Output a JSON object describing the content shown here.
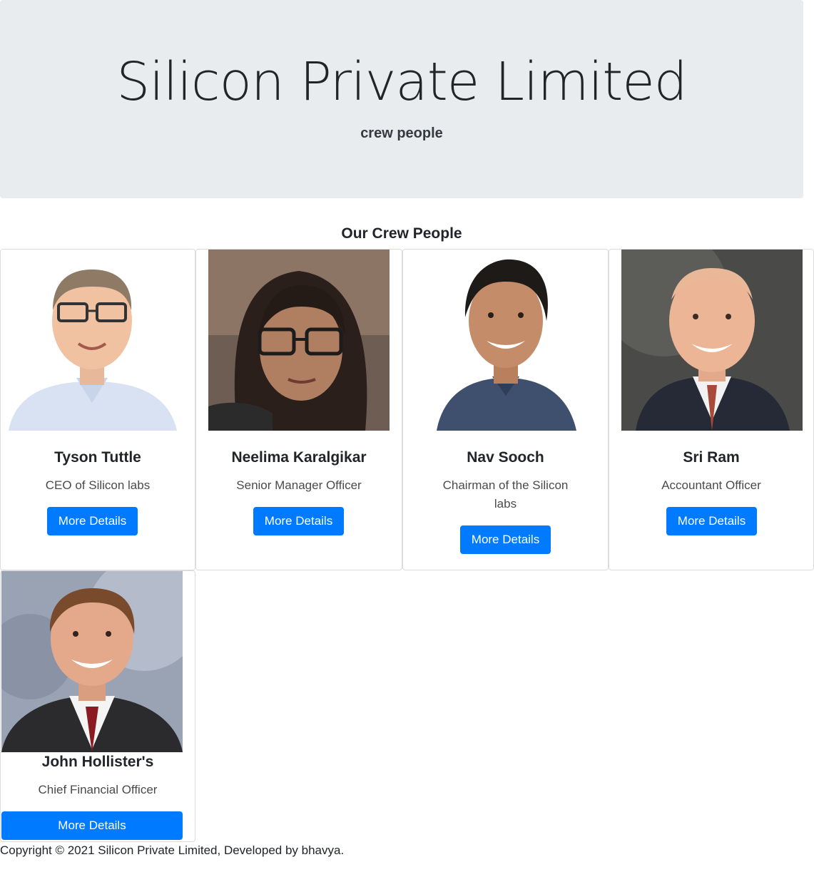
{
  "header": {
    "title": "Silicon Private Limited",
    "subtitle": "crew people"
  },
  "section": {
    "title": "Our Crew People"
  },
  "crew": [
    {
      "name": "Tyson Tuttle",
      "role": "CEO of Silicon labs",
      "button_label": "More Details"
    },
    {
      "name": "Neelima Karalgikar",
      "role": "Senior Manager Officer",
      "button_label": "More Details"
    },
    {
      "name": "Nav Sooch",
      "role": "Chairman of the Silicon labs",
      "button_label": "More Details"
    },
    {
      "name": "Sri Ram",
      "role": "Accountant Officer",
      "button_label": "More Details"
    },
    {
      "name": "John Hollister's",
      "role": "Chief Financial Officer",
      "button_label": "More Details"
    }
  ],
  "footer": {
    "text": "Copyright © 2021 Silicon Private Limited, Developed by bhavya."
  },
  "colors": {
    "jumbotron_bg": "#e9ecef",
    "button_bg": "#007bff",
    "card_border": "#dcdcdc"
  }
}
